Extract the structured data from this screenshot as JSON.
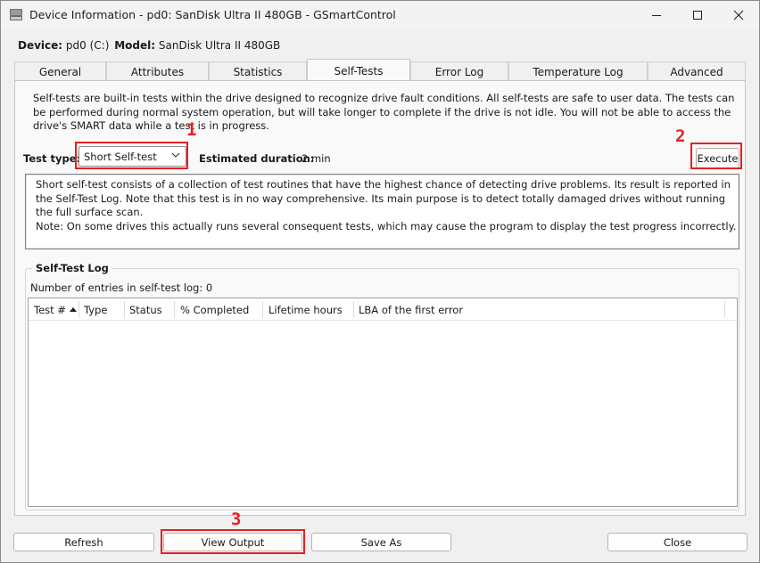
{
  "window": {
    "title": "Device Information - pd0: SanDisk Ultra II 480GB - GSmartControl",
    "icons": {
      "app": "drive-icon",
      "minimize": "minimize-icon",
      "maximize": "maximize-icon",
      "close": "close-icon"
    }
  },
  "device": {
    "device_label": "Device:",
    "device_value": "pd0 (C:)",
    "model_label": "Model:",
    "model_value": "SanDisk Ultra II 480GB"
  },
  "tabs": [
    {
      "label": "General",
      "active": false
    },
    {
      "label": "Attributes",
      "active": false
    },
    {
      "label": "Statistics",
      "active": false
    },
    {
      "label": "Self-Tests",
      "active": true
    },
    {
      "label": "Error Log",
      "active": false
    },
    {
      "label": "Temperature Log",
      "active": false
    },
    {
      "label": "Advanced",
      "active": false
    }
  ],
  "selftests": {
    "description": "Self-tests are built-in tests within the drive designed to recognize drive fault conditions. All self-tests are safe to user data. The tests can be performed during normal system operation, but will take longer to complete if the drive is not idle. You will not be able to access the drive's SMART data while a test is in progress.",
    "test_type_label": "Test type:",
    "test_type_value": "Short Self-test",
    "estimated_label": "Estimated duration:",
    "estimated_value": "2 min",
    "execute_label": "Execute",
    "test_description_lines": [
      "Short self-test consists of a collection of test routines that have the highest chance of detecting drive problems. Its result is reported in the Self-Test Log. Note that this test is in no way comprehensive. Its main purpose is to detect totally damaged drives without running the full surface scan.",
      "Note: On some drives this actually runs several consequent tests, which may cause the program to display the test progress incorrectly."
    ]
  },
  "log": {
    "group_title": "Self-Test Log",
    "entries_text": "Number of entries in self-test log: 0",
    "columns": [
      "Test #",
      "Type",
      "Status",
      "% Completed",
      "Lifetime hours",
      "LBA of the first error"
    ],
    "rows": []
  },
  "buttons": {
    "refresh": "Refresh",
    "view_output": "View Output",
    "save_as": "Save As",
    "close": "Close"
  },
  "annotations": {
    "color": "#e52020",
    "labels": [
      "1",
      "2",
      "3"
    ]
  }
}
